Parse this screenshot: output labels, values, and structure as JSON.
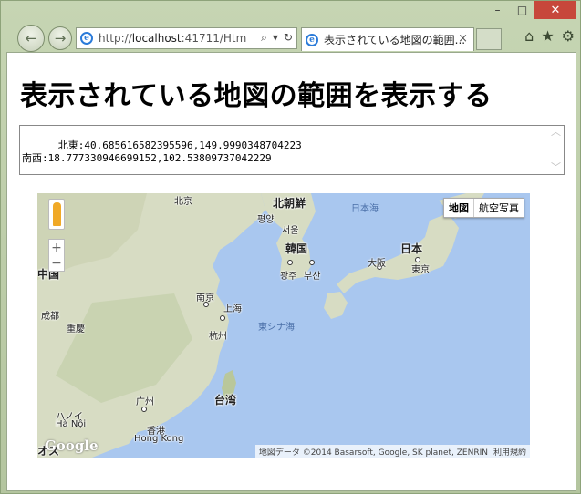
{
  "browser": {
    "address": {
      "prefix": "http://",
      "host": "localhost",
      "rest": ":41711/Htm"
    },
    "tab_title": "表示されている地図の範囲...",
    "tab_close": "×",
    "caption": {
      "minimize": "–",
      "maximize": "□",
      "close": "✕"
    }
  },
  "page": {
    "title": "表示されている地図の範囲を表示する",
    "bounds_text": "北東:40.685616582395596,149.9990348704223\n南西:18.777330946699152,102.53809737042229"
  },
  "map": {
    "type_buttons": {
      "map": "地図",
      "satellite": "航空写真"
    },
    "zoom_in": "+",
    "zoom_out": "−",
    "labels": {
      "beijing": "北京",
      "north_korea": "北朝鮮",
      "pyongyang": "평양",
      "seoul": "서울",
      "sea_of_japan": "日本海",
      "south_korea": "韓国",
      "gwangju": "광주",
      "busan": "부산",
      "japan": "日本",
      "osaka": "大阪",
      "tokyo": "東京",
      "china": "中国",
      "chengdu": "成都",
      "nanjing": "南京",
      "shanghai": "上海",
      "chongqing": "重慶",
      "hangzhou": "杭州",
      "east_china_sea": "東シナ海",
      "guangzhou": "广州",
      "taiwan": "台湾",
      "hanoi_ja": "ハノイ",
      "hanoi": "Hà Nội",
      "hongkong_ja": "香港",
      "hongkong": "Hong Kong",
      "edge": "オス"
    },
    "google": "Google",
    "attribution": "地図データ ©2014 Basarsoft, Google, SK planet, ZENRIN",
    "terms": "利用規約"
  },
  "colors": {
    "water": "#a9c7ef",
    "land": "#d7dcc3",
    "close": "#c7473b"
  }
}
